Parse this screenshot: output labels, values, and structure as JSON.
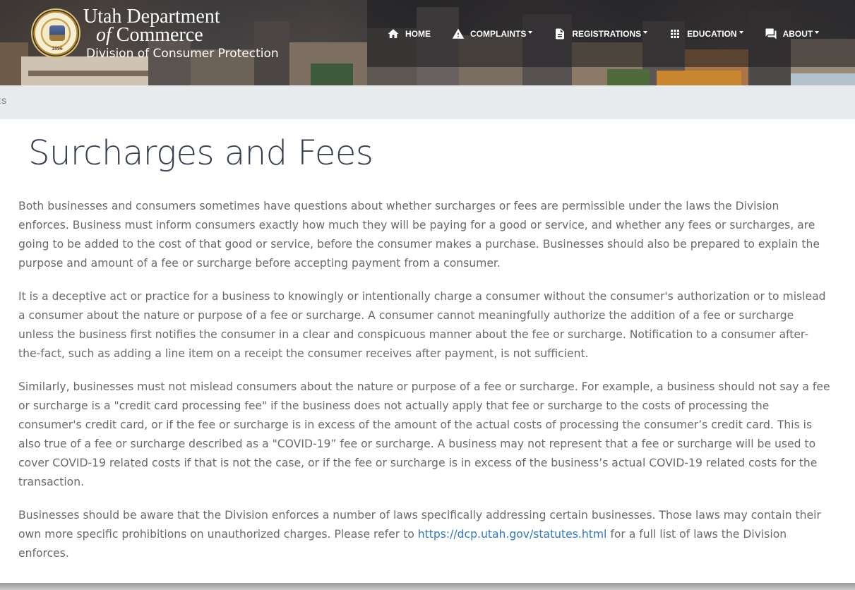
{
  "header": {
    "brand": {
      "line1": "Utah Department",
      "line2_of": "of",
      "line2_rest": " Commerce",
      "subtitle": "Division of Consumer Protection",
      "seal_year": "1896"
    },
    "nav": [
      {
        "label": "HOME",
        "icon": "home-icon",
        "dropdown": false
      },
      {
        "label": "COMPLAINTS",
        "icon": "warning-icon",
        "dropdown": true
      },
      {
        "label": "REGISTRATIONS",
        "icon": "document-icon",
        "dropdown": true
      },
      {
        "label": "EDUCATION",
        "icon": "grid-icon",
        "dropdown": true
      },
      {
        "label": "ABOUT",
        "icon": "chat-icon",
        "dropdown": true
      }
    ]
  },
  "breadcrumb": {
    "text": "ES"
  },
  "main": {
    "title": "Surcharges and Fees",
    "paragraphs": [
      "Both businesses and consumers sometimes have questions about whether surcharges or fees are permissible under the laws the Division enforces. Business must inform consumers exactly how much they will be paying for a good or service, and whether any fees or surcharges, are going to be added to the cost of that good or service, before the consumer makes a purchase. Businesses should also be prepared to explain the purpose and amount of a fee or surcharge before accepting payment from a consumer.",
      "It is a deceptive act or practice for a business to knowingly or intentionally charge a consumer without the consumer's authorization or to mislead a consumer about the nature or purpose of a fee or surcharge. A consumer cannot meaningfully authorize the addition of a fee or surcharge unless the business first notifies the consumer in a clear and conspicuous manner about the fee or surcharge. Notification to a consumer after-the-fact, such as adding a line item on a receipt the consumer receives after payment, is not sufficient.",
      "Similarly, businesses must not mislead consumers about the nature or purpose of a fee or surcharge. For example, a business should not say a fee or surcharge is a \"credit card processing fee\" if the business does not actually apply that fee or surcharge to the costs of processing the consumer's credit card, or if the fee or surcharge is in excess of the amount of the actual costs of processing the consumer’s credit card. This is also true of a fee or surcharge described as a \"COVID-19” fee or surcharge. A business may not represent that a fee or surcharge will be used to cover COVID-19 related costs if that is not the case, or if the fee or surcharge is in excess of the business’s actual COVID-19 related costs for the transaction."
    ],
    "last_paragraph": {
      "before_link": "Businesses should be aware that the Division enforces a number of laws specifically addressing certain businesses. Those laws may contain their own more specific prohibitions on unauthorized charges. Please refer to ",
      "link_text": "https://dcp.utah.gov/statutes.html",
      "after_link": " for a full list of laws the Division enforces."
    },
    "link_color": "#2f78c4"
  }
}
